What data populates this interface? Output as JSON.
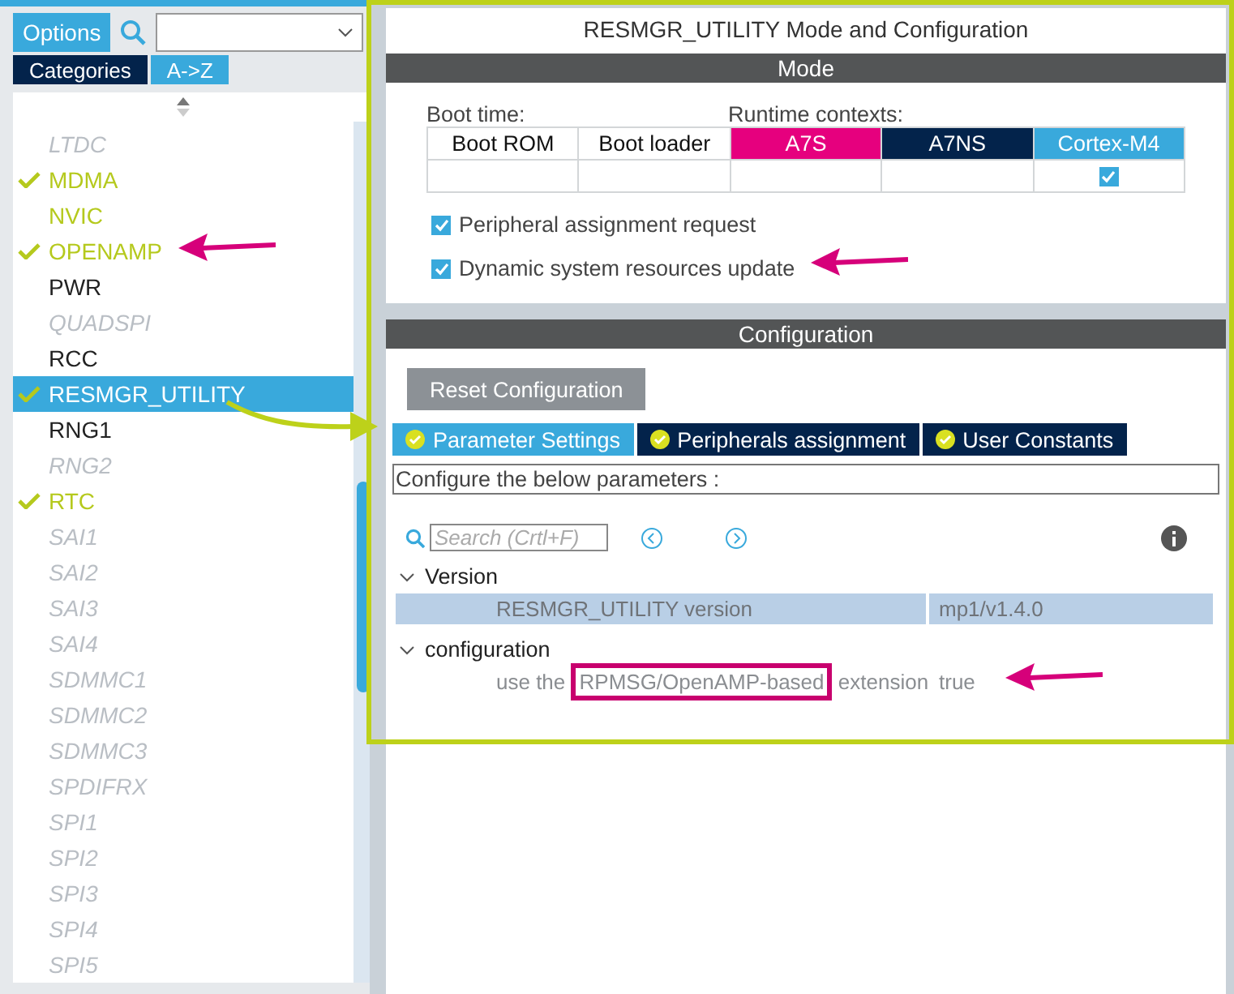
{
  "sidebar": {
    "options_button": "Options",
    "tabs": [
      {
        "label": "Categories",
        "selected": false
      },
      {
        "label": "A->Z",
        "selected": true
      }
    ],
    "items": [
      {
        "label": "LTDC",
        "kind": "unavailable",
        "checked": false,
        "selected": false
      },
      {
        "label": "MDMA",
        "kind": "configured",
        "checked": true,
        "selected": false
      },
      {
        "label": "NVIC",
        "kind": "configured",
        "checked": false,
        "selected": false
      },
      {
        "label": "OPENAMP",
        "kind": "configured",
        "checked": true,
        "selected": false
      },
      {
        "label": "PWR",
        "kind": "normal",
        "checked": false,
        "selected": false
      },
      {
        "label": "QUADSPI",
        "kind": "unavailable",
        "checked": false,
        "selected": false
      },
      {
        "label": "RCC",
        "kind": "normal",
        "checked": false,
        "selected": false
      },
      {
        "label": "RESMGR_UTILITY",
        "kind": "configured",
        "checked": true,
        "selected": true
      },
      {
        "label": "RNG1",
        "kind": "normal",
        "checked": false,
        "selected": false
      },
      {
        "label": "RNG2",
        "kind": "unavailable",
        "checked": false,
        "selected": false
      },
      {
        "label": "RTC",
        "kind": "configured",
        "checked": true,
        "selected": false
      },
      {
        "label": "SAI1",
        "kind": "unavailable",
        "checked": false,
        "selected": false
      },
      {
        "label": "SAI2",
        "kind": "unavailable",
        "checked": false,
        "selected": false
      },
      {
        "label": "SAI3",
        "kind": "unavailable",
        "checked": false,
        "selected": false
      },
      {
        "label": "SAI4",
        "kind": "unavailable",
        "checked": false,
        "selected": false
      },
      {
        "label": "SDMMC1",
        "kind": "unavailable",
        "checked": false,
        "selected": false
      },
      {
        "label": "SDMMC2",
        "kind": "unavailable",
        "checked": false,
        "selected": false
      },
      {
        "label": "SDMMC3",
        "kind": "unavailable",
        "checked": false,
        "selected": false
      },
      {
        "label": "SPDIFRX",
        "kind": "unavailable",
        "checked": false,
        "selected": false
      },
      {
        "label": "SPI1",
        "kind": "unavailable",
        "checked": false,
        "selected": false
      },
      {
        "label": "SPI2",
        "kind": "unavailable",
        "checked": false,
        "selected": false
      },
      {
        "label": "SPI3",
        "kind": "unavailable",
        "checked": false,
        "selected": false
      },
      {
        "label": "SPI4",
        "kind": "unavailable",
        "checked": false,
        "selected": false
      },
      {
        "label": "SPI5",
        "kind": "unavailable",
        "checked": false,
        "selected": false
      }
    ]
  },
  "main": {
    "title": "RESMGR_UTILITY Mode and Configuration",
    "mode": {
      "header": "Mode",
      "boot_time_label": "Boot time:",
      "runtime_label": "Runtime contexts:",
      "columns": [
        {
          "label": "Boot ROM",
          "color": "#ffffff",
          "checked": false
        },
        {
          "label": "Boot loader",
          "color": "#ffffff",
          "checked": false
        },
        {
          "label": "A7S",
          "color": "#e6007e",
          "checked": false
        },
        {
          "label": "A7NS",
          "color": "#03234b",
          "checked": false
        },
        {
          "label": "Cortex-M4",
          "color": "#39a9dc",
          "checked": true
        }
      ],
      "options": [
        {
          "label": "Peripheral assignment request",
          "checked": true
        },
        {
          "label": "Dynamic system resources update",
          "checked": true
        }
      ]
    },
    "configuration": {
      "header": "Configuration",
      "reset_button": "Reset Configuration",
      "tabs": [
        {
          "label": "Parameter Settings",
          "selected": true
        },
        {
          "label": "Peripherals assignment",
          "selected": false
        },
        {
          "label": "User Constants",
          "selected": false
        }
      ],
      "description": "Configure the below parameters :",
      "search": {
        "placeholder": "Search (Crtl+F)"
      },
      "groups": [
        {
          "label": "Version",
          "expanded": true,
          "params": [
            {
              "name": "RESMGR_UTILITY version",
              "value": "mp1/v1.4.0",
              "selected": true
            }
          ]
        },
        {
          "label": "configuration",
          "expanded": true,
          "params": [
            {
              "name": "use the **RPMSG/OpenAMP-based** extension",
              "value": "true",
              "selected": false
            }
          ]
        }
      ]
    }
  }
}
